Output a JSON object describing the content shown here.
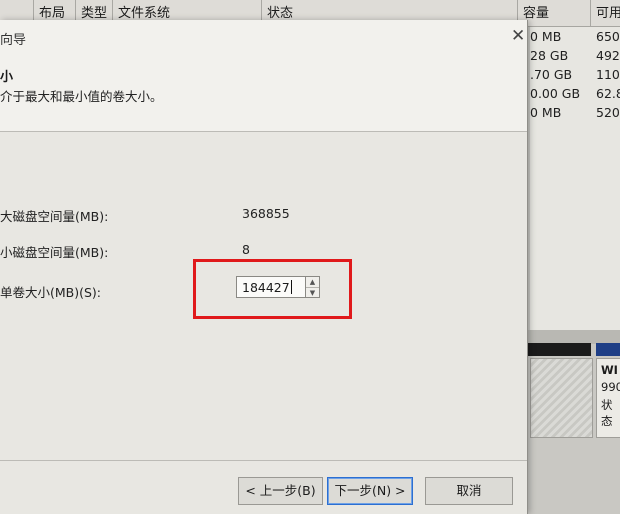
{
  "background_window": {
    "columns": [
      "",
      "布局",
      "类型",
      "文件系统",
      "状态",
      "容量",
      "可用"
    ],
    "capacity": [
      "0 MB",
      "28 GB",
      ".70 GB",
      "0.00 GB",
      "0 MB"
    ],
    "available": [
      "650",
      "492",
      "110",
      "62.8",
      "520"
    ],
    "partition_card": {
      "name": "WI",
      "size": "990",
      "status": "状态"
    }
  },
  "dialog": {
    "title": "向导",
    "heading": "小",
    "subheading": "介于最大和最小值的卷大小。",
    "max_label": "大磁盘空间量(MB):",
    "max_value": "368855",
    "min_label": "小磁盘空间量(MB):",
    "min_value": "8",
    "size_label": "单卷大小(MB)(S):",
    "size_value": "184427",
    "back_button": "< 上一步(B)",
    "next_button": "下一步(N) >",
    "cancel_button": "取消"
  },
  "colors": {
    "highlight": "#e0191b",
    "accent": "#2c6fd1"
  }
}
